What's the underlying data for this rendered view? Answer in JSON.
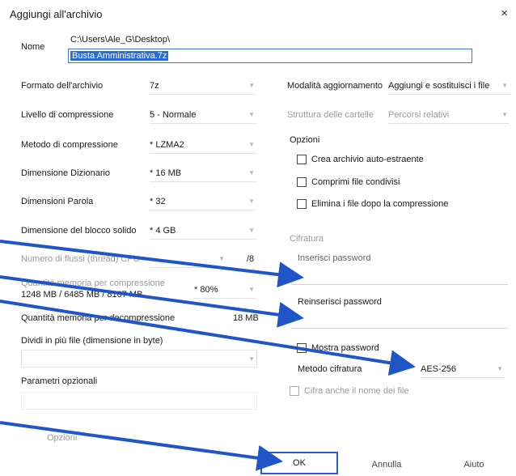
{
  "dialog": {
    "title": "Aggiungi all'archivio",
    "close_glyph": "×"
  },
  "name": {
    "label": "Nome",
    "path": "C:\\Users\\Ale_G\\Desktop\\",
    "value": "Busta Amministrativa.7z"
  },
  "left": {
    "format_label": "Formato dell'archivio",
    "format_value": "7z",
    "level_label": "Livello di compressione",
    "level_value": "5 - Normale",
    "method_label": "Metodo di compressione",
    "method_value": "* LZMA2",
    "dict_label": "Dimensione Dizionario",
    "dict_value": "* 16 MB",
    "word_label": "Dimensioni Parola",
    "word_value": "* 32",
    "solid_label": "Dimensione del blocco solido",
    "solid_value": "* 4 GB",
    "threads_label": "Numero di flussi (thread) CPU",
    "threads_value": "/8",
    "mem_comp_label": "Quantità memoria per compressione",
    "mem_comp_detail": "1248 MB / 6485 MB / 8107 MB",
    "mem_comp_value": "* 80%",
    "mem_decomp_label": "Quantità memoria per decompressione",
    "mem_decomp_value": "18 MB",
    "split_label": "Dividi in più file (dimensione in byte)",
    "params_label": "Parametri opzionali",
    "options_button": "Opzioni"
  },
  "right": {
    "update_label": "Modalità aggiornamento",
    "update_value": "Aggiungi e sostituisci i file",
    "paths_label": "Struttura delle cartelle",
    "paths_value": "Percorsi relativi",
    "options_title": "Opzioni",
    "opt_sfx": "Crea archivio auto-estraente",
    "opt_shared": "Comprimi file condivisi",
    "opt_delete": "Elimina i file dopo la compressione",
    "encryption_title": "Cifratura",
    "password_label": "Inserisci password",
    "repassword_label": "Reinserisci password",
    "show_password": "Mostra password",
    "enc_method_label": "Metodo cifratura",
    "enc_method_value": "AES-256",
    "encrypt_names": "Cifra anche il nome dei file"
  },
  "buttons": {
    "ok": "OK",
    "cancel": "Annulla",
    "help": "Aiuto"
  },
  "colors": {
    "accent": "#2a5bd6",
    "arrow": "#1f55c7",
    "selection": "#2b6cd6"
  }
}
